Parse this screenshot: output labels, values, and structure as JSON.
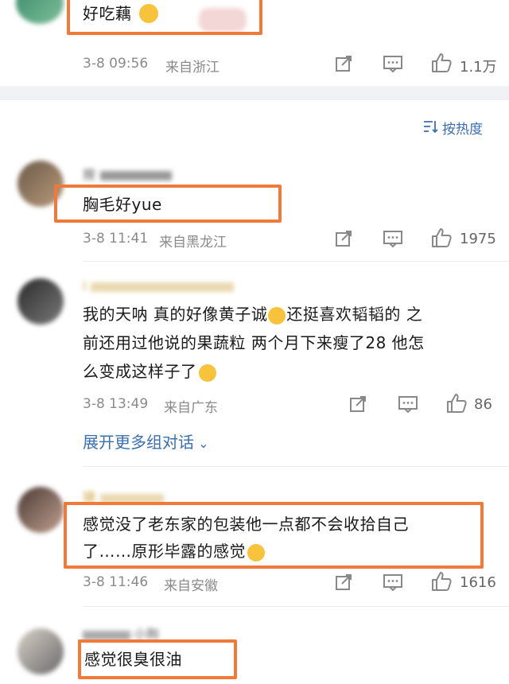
{
  "comments": [
    {
      "text": "好吃藕",
      "time": "3-8 09:56",
      "location": "来自浙江",
      "likes": "1.1万",
      "emoji": "smirk-emoji"
    },
    {
      "username_partial": "按",
      "text": "胸毛好yue",
      "time": "3-8 11:41",
      "location": "来自黑龙江",
      "likes": "1975"
    },
    {
      "username_partial": "i",
      "text_line1": "我的天呐 真的好像黄子诚",
      "text_line1b": "还挺喜欢韬韬的 之",
      "text_line2": "前还用过他说的果蔬粒 两个月下来瘦了28  他怎",
      "text_line3": "么变成这样子了",
      "time": "3-8 13:49",
      "location": "来自广东",
      "likes": "86",
      "expand": "展开更多组对话"
    },
    {
      "username_partial": "琦",
      "text_line1": "感觉没了老东家的包装他一点都不会收拾自己",
      "text_line2": "了……原形毕露的感觉",
      "time": "3-8 11:46",
      "location": "来自安徽",
      "likes": "1616"
    },
    {
      "username_partial": "小狗",
      "text": "感觉很臭很油"
    }
  ],
  "sort": {
    "label": "按热度"
  },
  "colors": {
    "highlight": "#f07a3a",
    "link": "#3a6fb2",
    "meta": "#8a8a8a"
  }
}
